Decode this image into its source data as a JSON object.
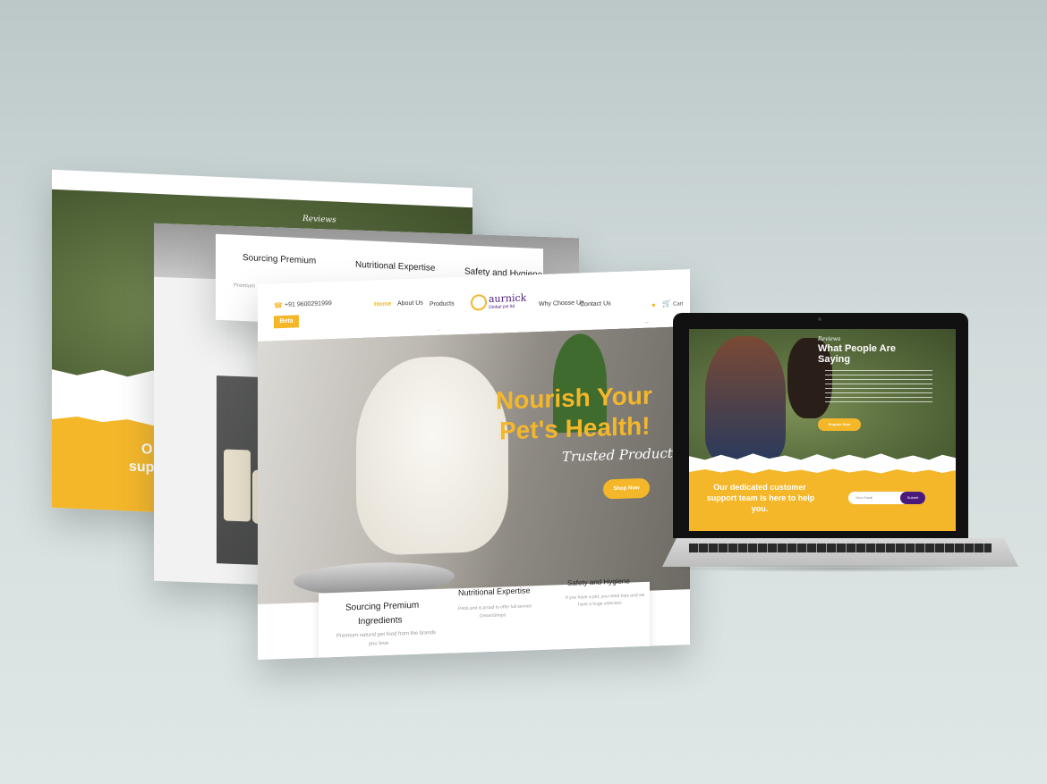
{
  "brand": {
    "name": "aurnick",
    "tagline": "Global pvt ltd"
  },
  "header": {
    "phone": "+91 9600291999",
    "badge": "Beta",
    "nav": [
      "Home",
      "About Us",
      "Products",
      "Why Choose Us",
      "Contact Us"
    ],
    "cart_label": "Cart"
  },
  "hero": {
    "title_line1": "Nourish Your",
    "title_line2": "Pet's Health!",
    "script": "Trusted Products",
    "cta": "Shop Now"
  },
  "features": [
    {
      "title_line1": "Sourcing Premium",
      "title_line2": "Ingredients",
      "desc_line1": "Premium natural pet food from the brands",
      "desc_line2": "you love"
    },
    {
      "title": "Nutritional Expertise",
      "desc_line1": "PetsLand is proud to offer full service",
      "desc_line2": "DreamShops"
    },
    {
      "title": "Safety and Hygiene",
      "desc_line1": "If you have a pet, you need toys and we",
      "desc_line2": "have a huge selection"
    }
  ],
  "back_card": {
    "features": [
      "Sourcing Premium",
      "Nutritional Expertise",
      "Safety and Hygiene"
    ],
    "desc_prefix": "Premium"
  },
  "reviews": {
    "script": "Reviews",
    "title_full_line1": "What People Are",
    "title_full_line2": "Saying",
    "cta": "Enquire Now",
    "support_line1": "Our dedicated customer",
    "support_line2": "support team is here to help",
    "support_line3": "you.",
    "email_placeholder": "Your Email",
    "submit": "Submit",
    "partial_line1": "O",
    "partial_line2": "sup"
  },
  "colors": {
    "accent": "#f4b72a",
    "purple": "#4a1a7a",
    "background": "#d3dcdc"
  }
}
